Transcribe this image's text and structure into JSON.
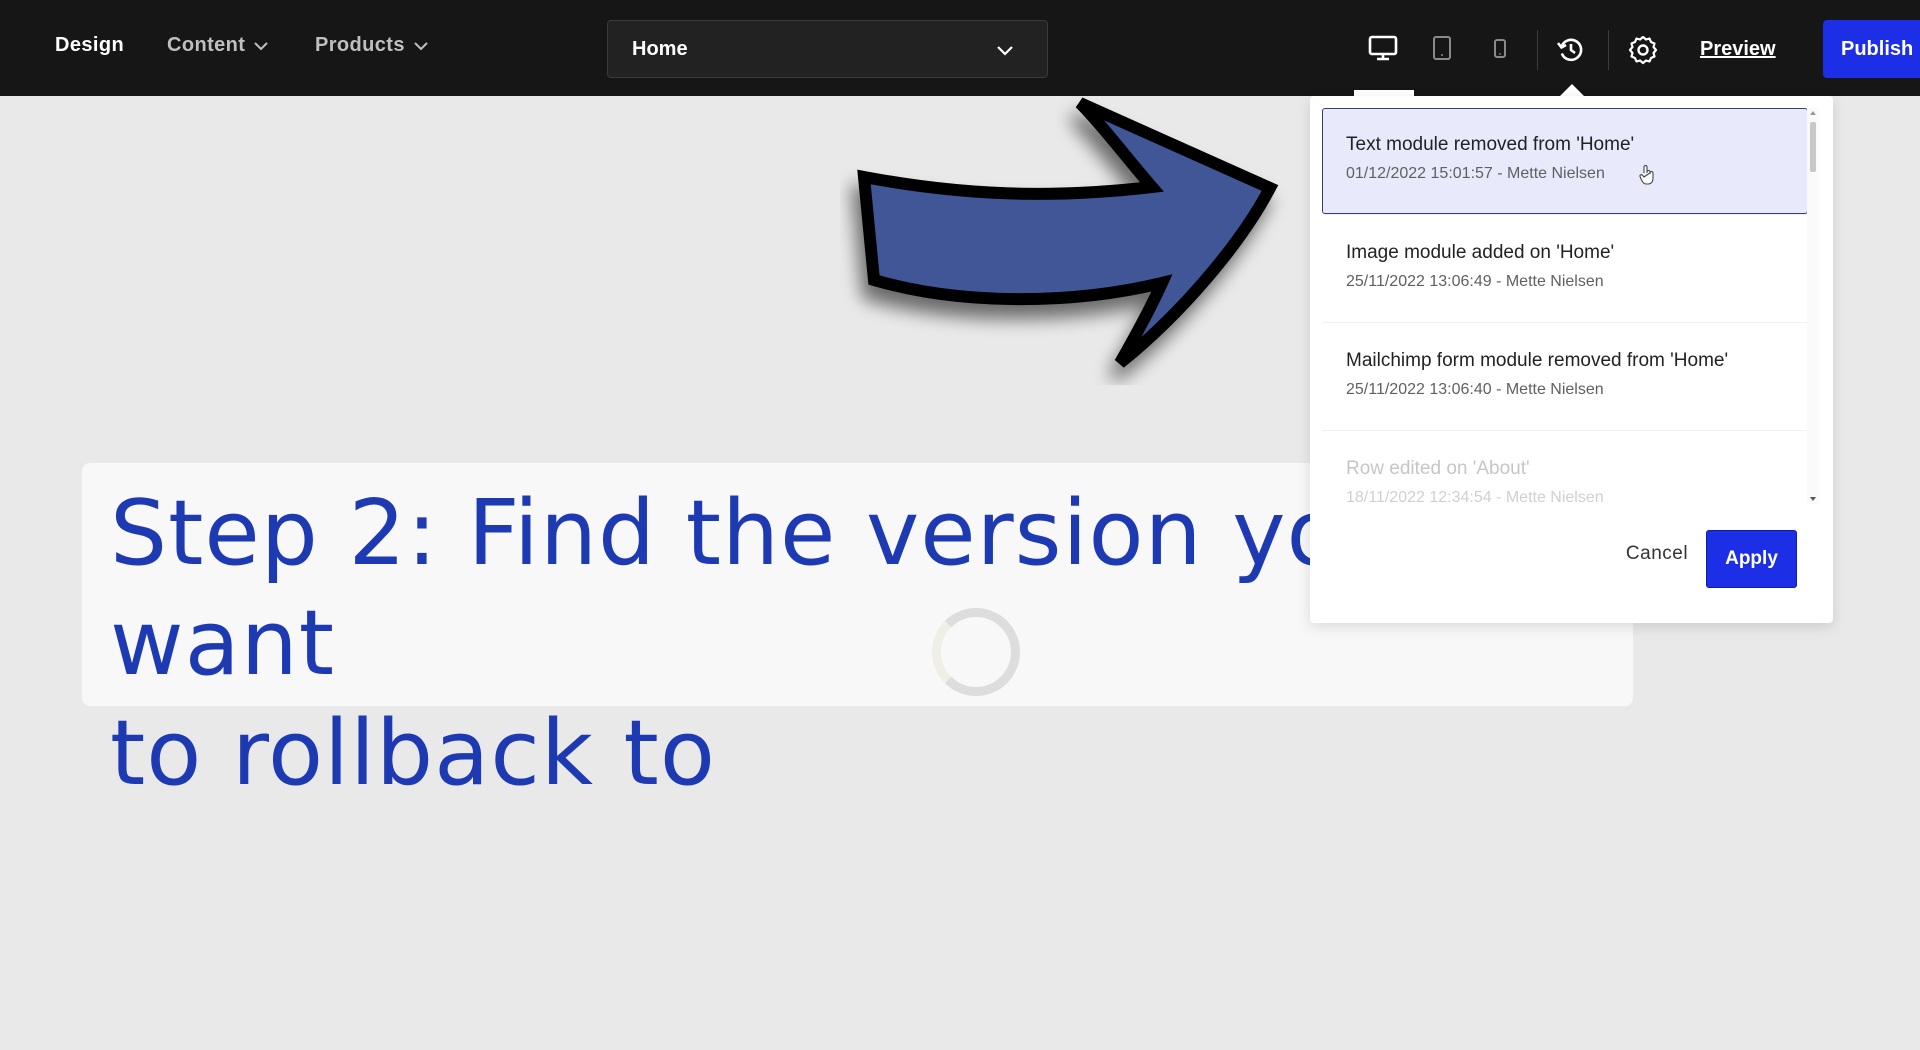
{
  "topbar": {
    "design_label": "Design",
    "content_label": "Content",
    "products_label": "Products",
    "page_select_value": "Home",
    "preview_label": "Preview",
    "publish_label": "Publish"
  },
  "history": {
    "items": [
      {
        "title": "Text module removed from 'Home'",
        "meta": "01/12/2022 15:01:57 - Mette Nielsen"
      },
      {
        "title": "Image module added on 'Home'",
        "meta": "25/11/2022 13:06:49 - Mette Nielsen"
      },
      {
        "title": "Mailchimp form module removed from 'Home'",
        "meta": "25/11/2022 13:06:40 - Mette Nielsen"
      },
      {
        "title": "Row edited on 'About'",
        "meta": "18/11/2022 12:34:54 - Mette Nielsen"
      }
    ],
    "cancel_label": "Cancel",
    "apply_label": "Apply"
  },
  "caption": {
    "line1": "Step 2: Find the version you want",
    "line2": "to rollback to"
  },
  "colors": {
    "topbar_bg": "#161616",
    "accent_blue": "#1c2ee6",
    "caption_text": "#1d3ab3",
    "arrow_fill": "#3f5797",
    "selected_item_bg": "#e8eafb"
  },
  "icons": {
    "desktop": "desktop-icon",
    "tablet": "tablet-icon",
    "mobile": "mobile-icon",
    "history": "history-icon",
    "settings": "gear-icon"
  }
}
